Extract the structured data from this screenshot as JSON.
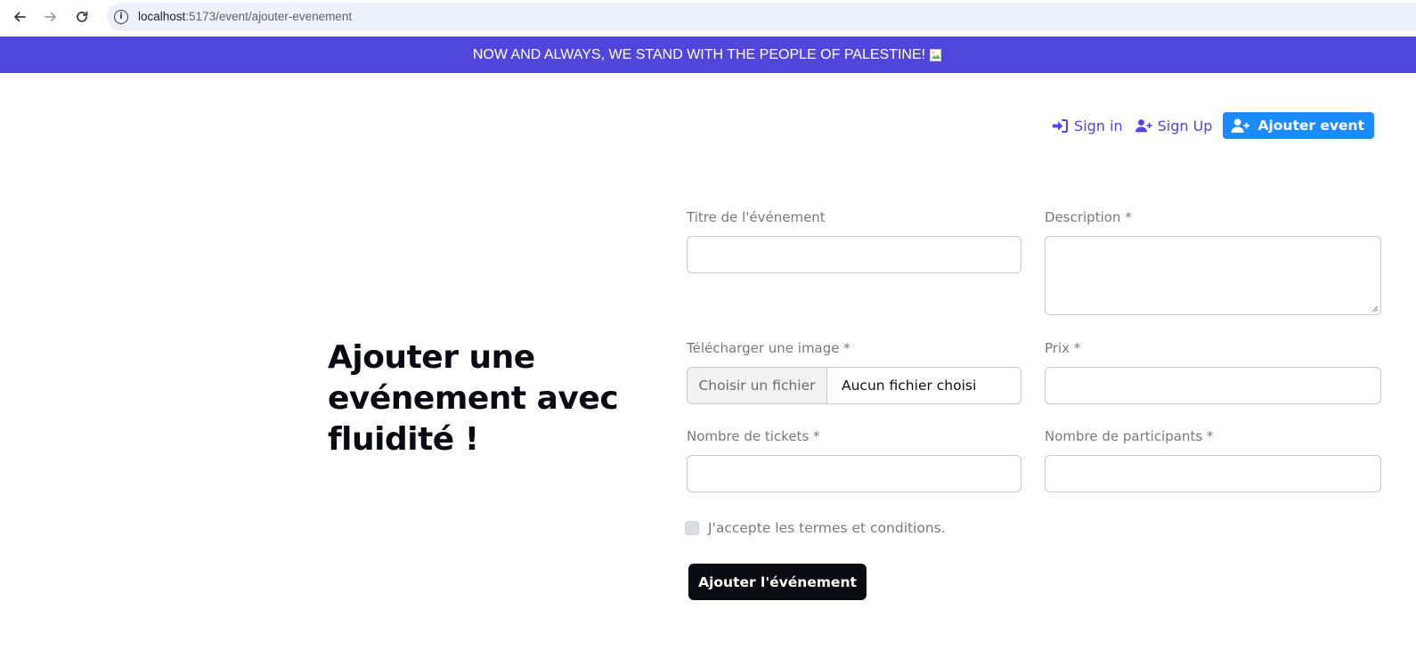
{
  "browser": {
    "url_host": "localhost",
    "url_path": ":5173/event/ajouter-evenement",
    "icons": {
      "back": "arrow-left-icon",
      "forward": "arrow-right-icon",
      "reload": "reload-icon",
      "info": "info-icon"
    },
    "info_glyph": "i"
  },
  "banner": {
    "text": "NOW AND ALWAYS, WE STAND WITH THE PEOPLE OF PALESTINE!",
    "color": "#5046dc"
  },
  "nav": {
    "sign_in": "Sign in",
    "sign_up": "Sign Up",
    "add_event": "Ajouter event",
    "link_color": "#4f46e5",
    "button_color": "#1a8cff"
  },
  "hero": {
    "title": "Ajouter une evénement avec fluidité !"
  },
  "form": {
    "title_label": "Titre de l'événement",
    "title_value": "",
    "description_label": "Description *",
    "description_value": "",
    "image_label": "Télécharger une image *",
    "file_button": "Choisir un fichier",
    "file_status": "Aucun fichier choisi",
    "price_label": "Prix *",
    "price_value": "",
    "tickets_label": "Nombre de tickets *",
    "tickets_value": "",
    "participants_label": "Nombre de participants *",
    "participants_value": "",
    "terms_label": "J'accepte les termes et conditions.",
    "terms_checked": false,
    "submit_label": "Ajouter l'événement"
  }
}
